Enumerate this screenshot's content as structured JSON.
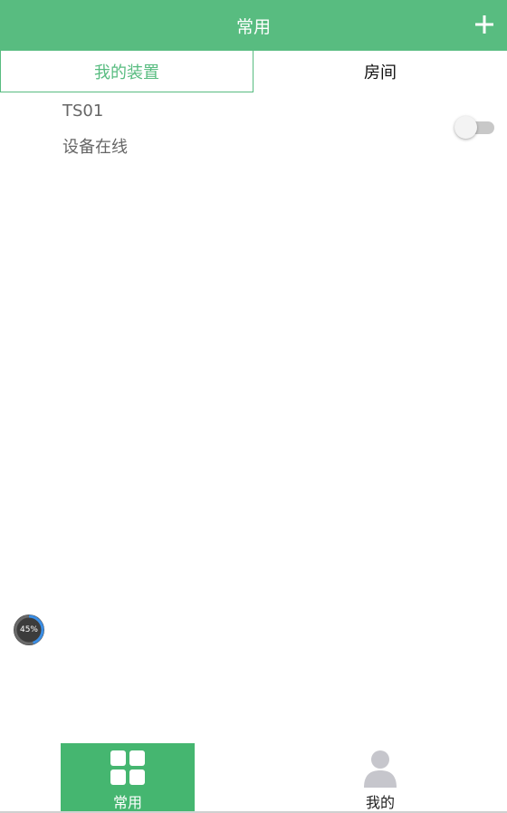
{
  "header": {
    "title": "常用",
    "add_icon": "plus-icon"
  },
  "tabs": [
    {
      "label": "我的装置",
      "active": true
    },
    {
      "label": "房间",
      "active": false
    }
  ],
  "devices": [
    {
      "name": "TS01",
      "status": "设备在线",
      "switch_on": false
    }
  ],
  "progress_badge": {
    "text": "45%",
    "value": 0.45
  },
  "bottom_nav": [
    {
      "label": "常用",
      "icon": "grid-icon",
      "active": true
    },
    {
      "label": "我的",
      "icon": "person-icon",
      "active": false
    }
  ],
  "colors": {
    "brand_green": "#58bc80",
    "nav_active_green": "#45b670",
    "text_gray": "#666666",
    "badge_ring_blue": "#3a8ee6"
  }
}
